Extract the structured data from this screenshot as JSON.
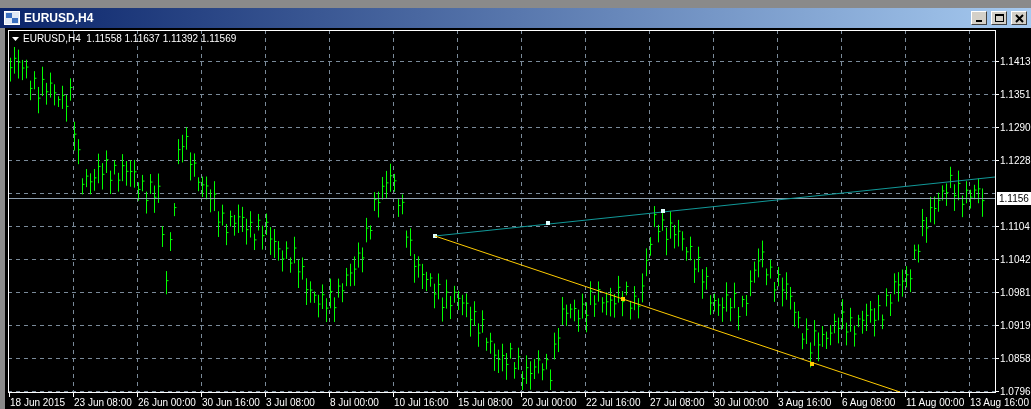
{
  "window": {
    "title": "EURUSD,H4",
    "buttons": [
      {
        "kind": "minimize"
      },
      {
        "kind": "maximize"
      },
      {
        "kind": "close"
      }
    ]
  },
  "chart": {
    "info": "EURUSD,H4  1.11558 1.11637 1.11392 1.11569",
    "price_axis": [
      "1.1413",
      "1.1351",
      "1.1290",
      "1.1228",
      "1.1104",
      "1.1042",
      "1.0981",
      "1.0919",
      "1.0858",
      "1.0796"
    ],
    "current_price": "1.1156",
    "time_axis": [
      "18 Jun 2015",
      "23 Jun 08:00",
      "26 Jun 00:00",
      "30 Jun 16:00",
      "3 Jul 08:00",
      "8 Jul 00:00",
      "10 Jul 16:00",
      "15 Jul 08:00",
      "20 Jul 00:00",
      "22 Jul 16:00",
      "27 Jul 08:00",
      "30 Jul 00:00",
      "3 Aug 16:00",
      "6 Aug 08:00",
      "11 Aug 00:00",
      "13 Aug 16:00"
    ]
  }
}
